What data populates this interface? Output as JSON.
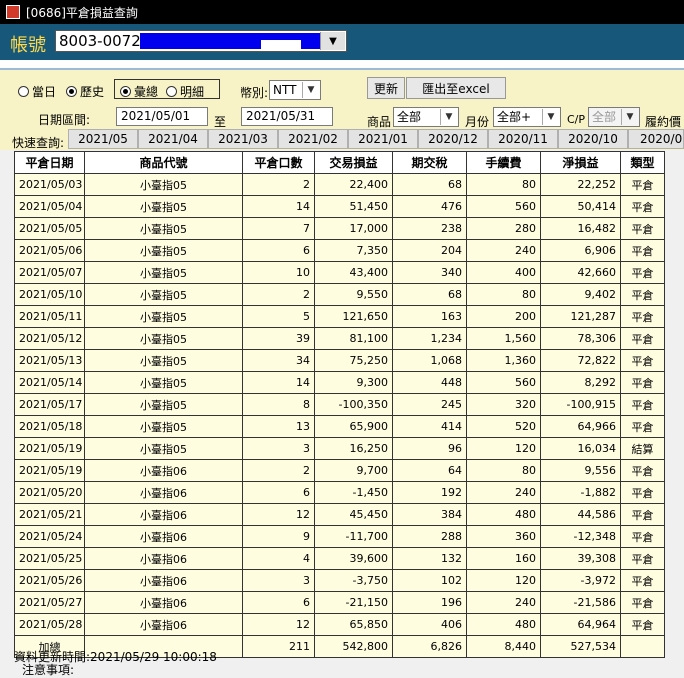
{
  "window": {
    "title": "[0686]平倉損益查詢"
  },
  "account": {
    "label": "帳號",
    "value": "8003-0072"
  },
  "filters": {
    "radio_today": "當日",
    "radio_history": "歷史",
    "radio_summary": "彙總",
    "radio_detail": "明細",
    "currency_label": "幣別:",
    "currency_value": "NTT",
    "refresh_label": "更新",
    "export_label": "匯出至excel",
    "date_range_label": "日期區間:",
    "date_from": "2021/05/01",
    "to_label": "至",
    "date_to": "2021/05/31",
    "product_label": "商品",
    "product_value": "全部",
    "month_label": "月份",
    "month_value": "全部+",
    "cp_label": "C/P",
    "cp_value": "全部",
    "expiry_label": "履約價"
  },
  "quick": {
    "label": "快速查詢:",
    "items": [
      "2021/05",
      "2021/04",
      "2021/03",
      "2021/02",
      "2021/01",
      "2020/12",
      "2020/11",
      "2020/10",
      "2020/0"
    ]
  },
  "table": {
    "columns": [
      "平倉日期",
      "商品代號",
      "平倉口數",
      "交易損益",
      "期交稅",
      "手續費",
      "淨損益",
      "類型"
    ],
    "rows": [
      [
        "2021/05/03",
        "小臺指05",
        "2",
        "22,400",
        "68",
        "80",
        "22,252",
        "平倉"
      ],
      [
        "2021/05/04",
        "小臺指05",
        "14",
        "51,450",
        "476",
        "560",
        "50,414",
        "平倉"
      ],
      [
        "2021/05/05",
        "小臺指05",
        "7",
        "17,000",
        "238",
        "280",
        "16,482",
        "平倉"
      ],
      [
        "2021/05/06",
        "小臺指05",
        "6",
        "7,350",
        "204",
        "240",
        "6,906",
        "平倉"
      ],
      [
        "2021/05/07",
        "小臺指05",
        "10",
        "43,400",
        "340",
        "400",
        "42,660",
        "平倉"
      ],
      [
        "2021/05/10",
        "小臺指05",
        "2",
        "9,550",
        "68",
        "80",
        "9,402",
        "平倉"
      ],
      [
        "2021/05/11",
        "小臺指05",
        "5",
        "121,650",
        "163",
        "200",
        "121,287",
        "平倉"
      ],
      [
        "2021/05/12",
        "小臺指05",
        "39",
        "81,100",
        "1,234",
        "1,560",
        "78,306",
        "平倉"
      ],
      [
        "2021/05/13",
        "小臺指05",
        "34",
        "75,250",
        "1,068",
        "1,360",
        "72,822",
        "平倉"
      ],
      [
        "2021/05/14",
        "小臺指05",
        "14",
        "9,300",
        "448",
        "560",
        "8,292",
        "平倉"
      ],
      [
        "2021/05/17",
        "小臺指05",
        "8",
        "-100,350",
        "245",
        "320",
        "-100,915",
        "平倉"
      ],
      [
        "2021/05/18",
        "小臺指05",
        "13",
        "65,900",
        "414",
        "520",
        "64,966",
        "平倉"
      ],
      [
        "2021/05/19",
        "小臺指05",
        "3",
        "16,250",
        "96",
        "120",
        "16,034",
        "結算"
      ],
      [
        "2021/05/19",
        "小臺指06",
        "2",
        "9,700",
        "64",
        "80",
        "9,556",
        "平倉"
      ],
      [
        "2021/05/20",
        "小臺指06",
        "6",
        "-1,450",
        "192",
        "240",
        "-1,882",
        "平倉"
      ],
      [
        "2021/05/21",
        "小臺指06",
        "12",
        "45,450",
        "384",
        "480",
        "44,586",
        "平倉"
      ],
      [
        "2021/05/24",
        "小臺指06",
        "9",
        "-11,700",
        "288",
        "360",
        "-12,348",
        "平倉"
      ],
      [
        "2021/05/25",
        "小臺指06",
        "4",
        "39,600",
        "132",
        "160",
        "39,308",
        "平倉"
      ],
      [
        "2021/05/26",
        "小臺指06",
        "3",
        "-3,750",
        "102",
        "120",
        "-3,972",
        "平倉"
      ],
      [
        "2021/05/27",
        "小臺指06",
        "6",
        "-21,150",
        "196",
        "240",
        "-21,586",
        "平倉"
      ],
      [
        "2021/05/28",
        "小臺指06",
        "12",
        "65,850",
        "406",
        "480",
        "64,964",
        "平倉"
      ]
    ],
    "total": [
      "加總",
      "",
      "211",
      "542,800",
      "6,826",
      "8,440",
      "527,534",
      ""
    ]
  },
  "footer": {
    "updated": "資料更新時間:2021/05/29 10:00:18",
    "notes": "注意事項:"
  },
  "colors": {
    "titlebar": "#000000",
    "account_bar": "#17587a",
    "account_label": "#ffd84a",
    "filter_bg": "#f7f3c7",
    "grid_bg": "#fffde0",
    "mask": "#0000ee"
  },
  "icons": {
    "app": "app-icon",
    "dropdown": "chevron-down-icon"
  }
}
